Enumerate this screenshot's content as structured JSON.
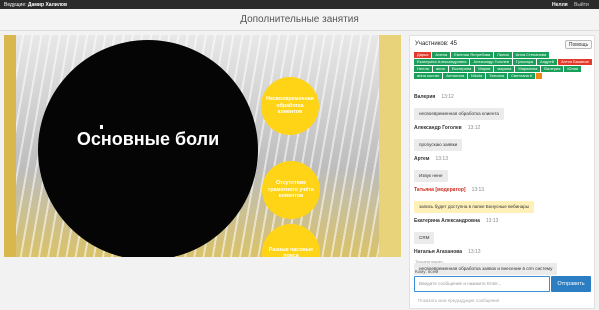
{
  "topbar": {
    "presenter_label": "Ведущие:",
    "presenter_name": "Дамир Халилов",
    "user": "Нелля",
    "exit": "Выйти"
  },
  "page_title": "Дополнительные занятия",
  "slide": {
    "main_text": "Основные боли",
    "points": [
      "Несвоевременная обработка клиентов",
      "Отсутствие грамотного учёта клиентов",
      "Разные часовые пояса"
    ]
  },
  "panel": {
    "participants_label": "Участников: 45",
    "help_label": "Помощь",
    "tags": [
      {
        "text": "Дарья",
        "color": "red"
      },
      {
        "text": "Алена",
        "color": "green"
      },
      {
        "text": "Евгения Ястребова",
        "color": "green"
      },
      {
        "text": "Лилия",
        "color": "green"
      },
      {
        "text": "Анна Степанова",
        "color": "green"
      },
      {
        "text": "Екатерина Александровна",
        "color": "green"
      },
      {
        "text": "Александр Гоголев",
        "color": "green"
      },
      {
        "text": "Гульнара",
        "color": "green"
      },
      {
        "text": "Андрей",
        "color": "green"
      },
      {
        "text": "Антон Базанов",
        "color": "red"
      },
      {
        "text": "Нелля",
        "color": "green"
      },
      {
        "text": "анна",
        "color": "green"
      },
      {
        "text": "Екатерина",
        "color": "green"
      },
      {
        "text": "Мария",
        "color": "green"
      },
      {
        "text": "марина",
        "color": "green"
      },
      {
        "text": "Марианна",
        "color": "green"
      },
      {
        "text": "Валерия",
        "color": "green"
      },
      {
        "text": "Юлия",
        "color": "green"
      },
      {
        "text": "анна костин",
        "color": "green"
      },
      {
        "text": "Антонина",
        "color": "green"
      },
      {
        "text": "Nikola",
        "color": "green"
      },
      {
        "text": "Татьяна",
        "color": "green"
      },
      {
        "text": "Светлана К",
        "color": "green"
      },
      {
        "text": "",
        "color": "orange"
      }
    ],
    "messages": [
      {
        "author": "Валерия",
        "time": "13:12",
        "text": "несвоевременная обработка клиента",
        "moderator": false
      },
      {
        "author": "Александр Гоголев",
        "time": "13:12",
        "text": "пропускаю заявки",
        "moderator": false
      },
      {
        "author": "Артем",
        "time": "13:13",
        "text": "Извук ннне",
        "moderator": false
      },
      {
        "author": "Татьяна [модератор]",
        "time": "13:13",
        "text": "запись будет доступна в папке Бонусные вебинары",
        "moderator": true
      },
      {
        "author": "Екатерина Александровна",
        "time": "13:13",
        "text": "CRM",
        "moderator": false
      },
      {
        "author": "Наталья Агаханова",
        "time": "13:13",
        "text": "несвоевременная обработка заявок и внесение в crm систему",
        "moderator": false
      }
    ],
    "typing": "Татьяна пишет...",
    "whom": "Кому: всем",
    "input_placeholder": "Введите сообщение и нажмите Enter...",
    "send_label": "Отправить",
    "earlier_label": "Показать мои предыдущие сообщения"
  },
  "colors": {
    "green": "#1aa05a",
    "red": "#e23b2d",
    "yellow": "#ffd416",
    "send": "#2b7ec1"
  }
}
